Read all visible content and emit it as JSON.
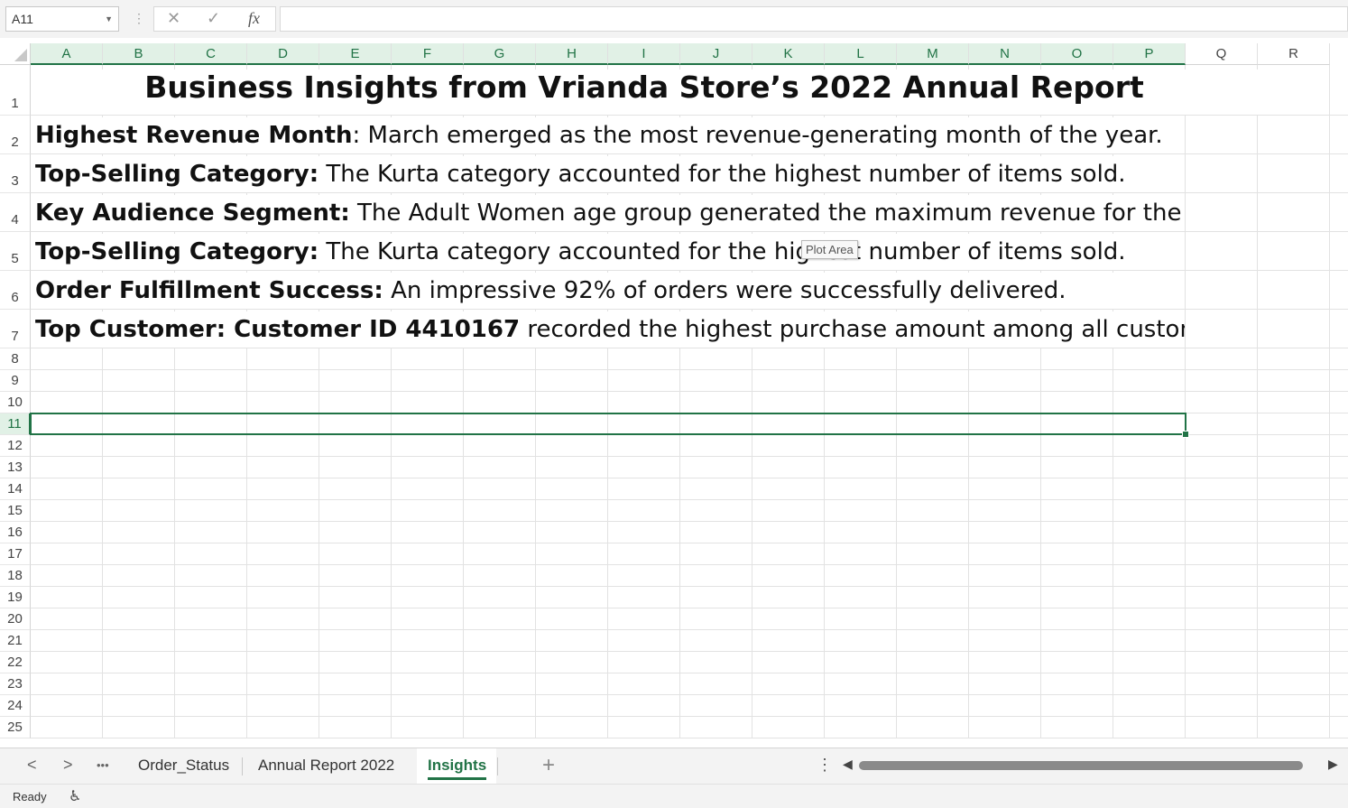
{
  "formula_bar": {
    "name_box": "A11",
    "cancel_icon": "✕",
    "enter_icon": "✓",
    "fx_label": "fx",
    "formula": ""
  },
  "columns": [
    "A",
    "B",
    "C",
    "D",
    "E",
    "F",
    "G",
    "H",
    "I",
    "J",
    "K",
    "L",
    "M",
    "N",
    "O",
    "P",
    "Q",
    "R"
  ],
  "rows": [
    "1",
    "2",
    "3",
    "4",
    "5",
    "6",
    "7",
    "8",
    "9",
    "10",
    "11",
    "12",
    "13",
    "14",
    "15",
    "16",
    "17",
    "18",
    "19",
    "20",
    "21",
    "22",
    "23",
    "24",
    "25"
  ],
  "selected_cell": "A11",
  "sheet": {
    "title": "Business Insights from Vrianda Store’s 2022 Annual Report",
    "insights": [
      {
        "label": "Highest Revenue Month",
        "sep": ": ",
        "text": "March emerged as the most revenue-generating month of the year."
      },
      {
        "label": "Top-Selling Category:",
        "sep": " ",
        "text": "The Kurta category accounted for the highest number of items sold."
      },
      {
        "label": "Key Audience Segment:",
        "sep": " ",
        "text": "The Adult Women age group generated the maximum revenue for the s"
      },
      {
        "label": "Top-Selling Category:",
        "sep": " ",
        "text": "The Kurta category accounted for the highest number of items sold."
      },
      {
        "label": "Order Fulfillment Success:",
        "sep": " ",
        "text": "An impressive 92% of orders were successfully delivered."
      },
      {
        "label": "Top Customer: Customer ID 4410167",
        "sep": " ",
        "text": "recorded the highest purchase amount among all custome"
      }
    ]
  },
  "tooltip": "Plot Area",
  "tabs": {
    "prev": "<",
    "next": ">",
    "more": "•••",
    "sheets": [
      "Order_Status",
      "Annual Report 2022",
      "Insights"
    ],
    "active": "Insights",
    "add": "+",
    "options": "⋮"
  },
  "status": {
    "text": "Ready",
    "accessibility_icon": "accessibility-check-icon"
  },
  "colors": {
    "accent": "#217346"
  }
}
